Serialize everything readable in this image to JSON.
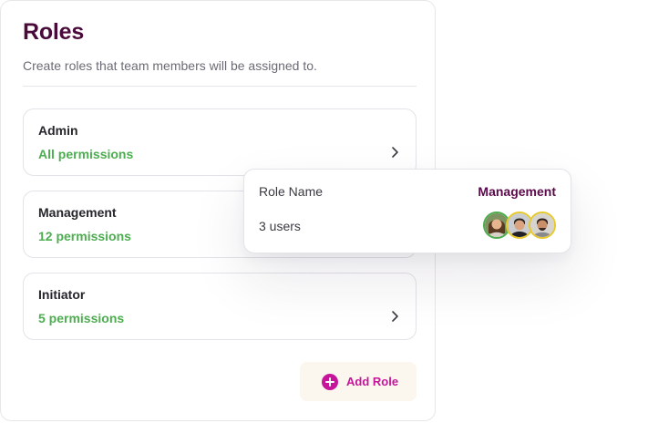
{
  "header": {
    "title": "Roles",
    "subtitle": "Create roles that team members will be assigned to."
  },
  "roles": [
    {
      "name": "Admin",
      "permissions": "All permissions"
    },
    {
      "name": "Management",
      "permissions": "12 permissions"
    },
    {
      "name": "Initiator",
      "permissions": "5 permissions"
    }
  ],
  "add_role": {
    "label": "Add Role",
    "icon": "plus-circle-icon"
  },
  "popover": {
    "label": "Role Name",
    "value": "Management",
    "users": "3 users",
    "avatars": [
      {
        "icon": "user-avatar-1",
        "ring_color": "#4cae4f"
      },
      {
        "icon": "user-avatar-2",
        "ring_color": "#e6c92c"
      },
      {
        "icon": "user-avatar-3",
        "ring_color": "#e6c92c"
      }
    ]
  },
  "colors": {
    "title": "#4a0a3a",
    "permission_text": "#4cae4f",
    "accent": "#c7159b",
    "button_background": "#fbf6ee"
  }
}
